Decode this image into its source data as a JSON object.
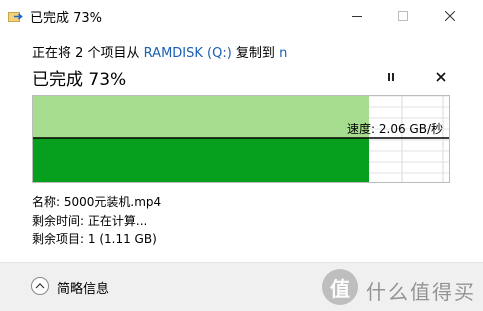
{
  "window": {
    "title": "已完成 73%",
    "icon": "copy-files-icon"
  },
  "copy": {
    "prefix": "正在将 2 个项目从 ",
    "source": "RAMDISK (Q:)",
    "middle": " 复制到 ",
    "destination": "n",
    "status": "已完成 73%",
    "progress_percent": 73
  },
  "chart": {
    "speed_label": "速度: 2.06 GB/秒",
    "colors": {
      "bar": "#06a01e",
      "history": "#a6dc8e",
      "speed_line": "#000000"
    }
  },
  "details": {
    "name_label": "名称:",
    "name_value": "5000元装机.mp4",
    "time_label": "剩余时间:",
    "time_value": "正在计算...",
    "items_label": "剩余项目:",
    "items_value": "1 (1.11 GB)"
  },
  "footer": {
    "expand_label": "简略信息",
    "watermark_text": "什么值得买",
    "watermark_logo": "值"
  }
}
